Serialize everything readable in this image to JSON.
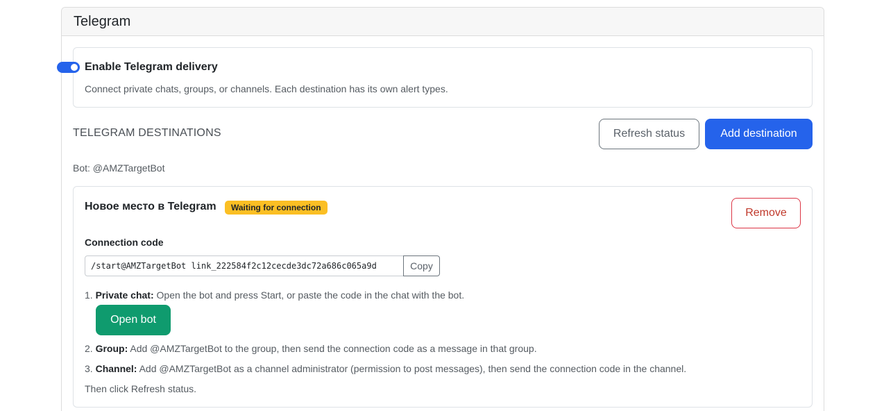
{
  "card": {
    "title": "Telegram"
  },
  "toggle": {
    "label": "Enable Telegram delivery",
    "enabled": true,
    "help": "Connect private chats, groups, or channels. Each destination has its own alert types."
  },
  "destinations": {
    "section_title": "TELEGRAM DESTINATIONS",
    "refresh_label": "Refresh status",
    "add_label": "Add destination",
    "bot_line": "Bot: @AMZTargetBot"
  },
  "destination": {
    "name": "Новое место в Telegram",
    "status_badge": "Waiting for connection",
    "remove_label": "Remove",
    "code_label": "Connection code",
    "code_value": "/start@AMZTargetBot link_222584f2c12cecde3dc72a686c065a9d",
    "copy_label": "Copy",
    "step1_prefix": "1. ",
    "step1_title": "Private chat:",
    "step1_text": " Open the bot and press Start, or paste the code in the chat with the bot.",
    "open_bot_label": "Open bot",
    "step2_prefix": "2. ",
    "step2_title": "Group:",
    "step2_text": " Add @AMZTargetBot to the group, then send the connection code as a message in that group.",
    "step3_prefix": "3. ",
    "step3_title": "Channel:",
    "step3_text": " Add @AMZTargetBot as a channel administrator (permission to post messages), then send the connection code in the channel.",
    "then_text": "Then click Refresh status."
  },
  "colors": {
    "primary": "#2563eb",
    "success": "#0f9b6e",
    "danger": "#dc3545",
    "warning": "#fbbf24"
  }
}
